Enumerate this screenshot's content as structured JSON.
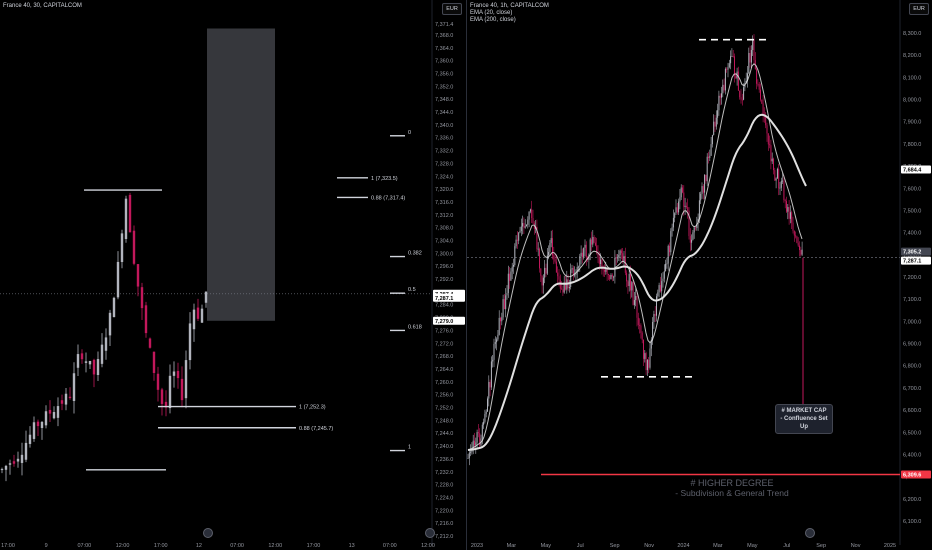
{
  "left": {
    "title": "France 40, 30, CAPITALCOM",
    "currency": "EUR",
    "price_ticks": [
      "7,371.4",
      "7,368.0",
      "7,364.0",
      "7,360.0",
      "7,356.0",
      "7,352.0",
      "7,348.0",
      "7,344.0",
      "7,340.0",
      "7,336.0",
      "7,332.0",
      "7,328.0",
      "7,324.0",
      "7,320.0",
      "7,316.0",
      "7,312.0",
      "7,308.0",
      "7,304.0",
      "7,300.0",
      "7,296.0",
      "7,292.0",
      "7,288.0",
      "7,284.0",
      "7,280.0",
      "7,276.0",
      "7,272.0",
      "7,268.0",
      "7,264.0",
      "7,260.0",
      "7,256.0",
      "7,252.0",
      "7,248.0",
      "7,244.0",
      "7,240.0",
      "7,236.0",
      "7,232.0",
      "7,228.0",
      "7,224.0",
      "7,220.0",
      "7,216.0",
      "7,212.0"
    ],
    "price_badges": [
      {
        "label": "7,287.4",
        "value": 7287.4,
        "color": "#ffffff",
        "text": "#000000"
      },
      {
        "label": "7,287.1",
        "value": 7287.1,
        "color": "#ffffff",
        "text": "#000000"
      },
      {
        "label": "7,279.0",
        "value": 7279.0,
        "color": "#ffffff",
        "text": "#000000"
      }
    ],
    "time_ticks": [
      "17:00",
      "9",
      "07:00",
      "12:00",
      "17:00",
      "12",
      "07:00",
      "12:00",
      "17:00",
      "13",
      "07:00",
      "12:00"
    ],
    "fib_retracement": [
      {
        "label": "0",
        "value": 7336.6
      },
      {
        "label": "0.382",
        "value": 7299.0
      },
      {
        "label": "0.5",
        "value": 7287.6
      },
      {
        "label": "0.618",
        "value": 7276.0
      },
      {
        "label": "1",
        "value": 7238.6
      }
    ],
    "fib_extension": [
      {
        "label": "1 (7,323.5)",
        "value": 7323.5
      },
      {
        "label": "0.88 (7,317.4)",
        "value": 7317.4
      },
      {
        "label": "1 (7,252.3)",
        "value": 7252.3
      },
      {
        "label": "0.88 (7,245.7)",
        "value": 7245.7
      }
    ],
    "levels": [
      {
        "name": "swing-high-line",
        "value": 7319.7
      },
      {
        "name": "swing-low-line",
        "value": 7232.6
      }
    ],
    "zone": {
      "top": 7370.0,
      "bottom": 7279.0
    },
    "last_price": 7287.4
  },
  "right": {
    "title": "France 40, 1h, CAPITALCOM",
    "ema_fast": "EMA (20, close)",
    "ema_slow": "EMA (200, close)",
    "currency": "EUR",
    "price_ticks": [
      "8,300.0",
      "8,200.0",
      "8,100.0",
      "8,000.0",
      "7,900.0",
      "7,800.0",
      "7,700.0",
      "7,600.0",
      "7,500.0",
      "7,400.0",
      "7,300.0",
      "7,200.0",
      "7,100.0",
      "7,000.0",
      "6,900.0",
      "6,800.0",
      "6,700.0",
      "6,600.0",
      "6,500.0",
      "6,400.0",
      "6,300.0",
      "6,200.0",
      "6,100.0"
    ],
    "price_badges": [
      {
        "label": "7,684.4",
        "value": 7684.4,
        "color": "#ffffff",
        "text": "#000000"
      },
      {
        "label": "7,305.2",
        "value": 7305.2,
        "color": "#434651",
        "text": "#ffffff"
      },
      {
        "label": "7,287.1",
        "value": 7287.1,
        "color": "#ffffff",
        "text": "#000000"
      },
      {
        "label": "6,309.6",
        "value": 6309.6,
        "color": "#f23645",
        "text": "#ffffff"
      }
    ],
    "time_ticks": [
      "2023",
      "Mar",
      "May",
      "Jul",
      "Sep",
      "Nov",
      "2024",
      "Mar",
      "May",
      "Jul",
      "Sep",
      "Nov",
      "2025"
    ],
    "annotation": {
      "line1": "# MARKET CAP",
      "line2": "- Confluence Set Up"
    },
    "higher_degree": {
      "line1": "# HIGHER DEGREE",
      "line2": "- Subdivision & General Trend"
    },
    "higher_degree_level": 6309.6,
    "top_dashed_level": 8270,
    "bottom_dashed_level": 6750,
    "crosshair_level": 7287.1
  },
  "colors": {
    "bg": "#000000",
    "up": "#b2b5be",
    "down": "#c2185b",
    "red_line": "#f23645",
    "ema": "#e0e0e0"
  }
}
